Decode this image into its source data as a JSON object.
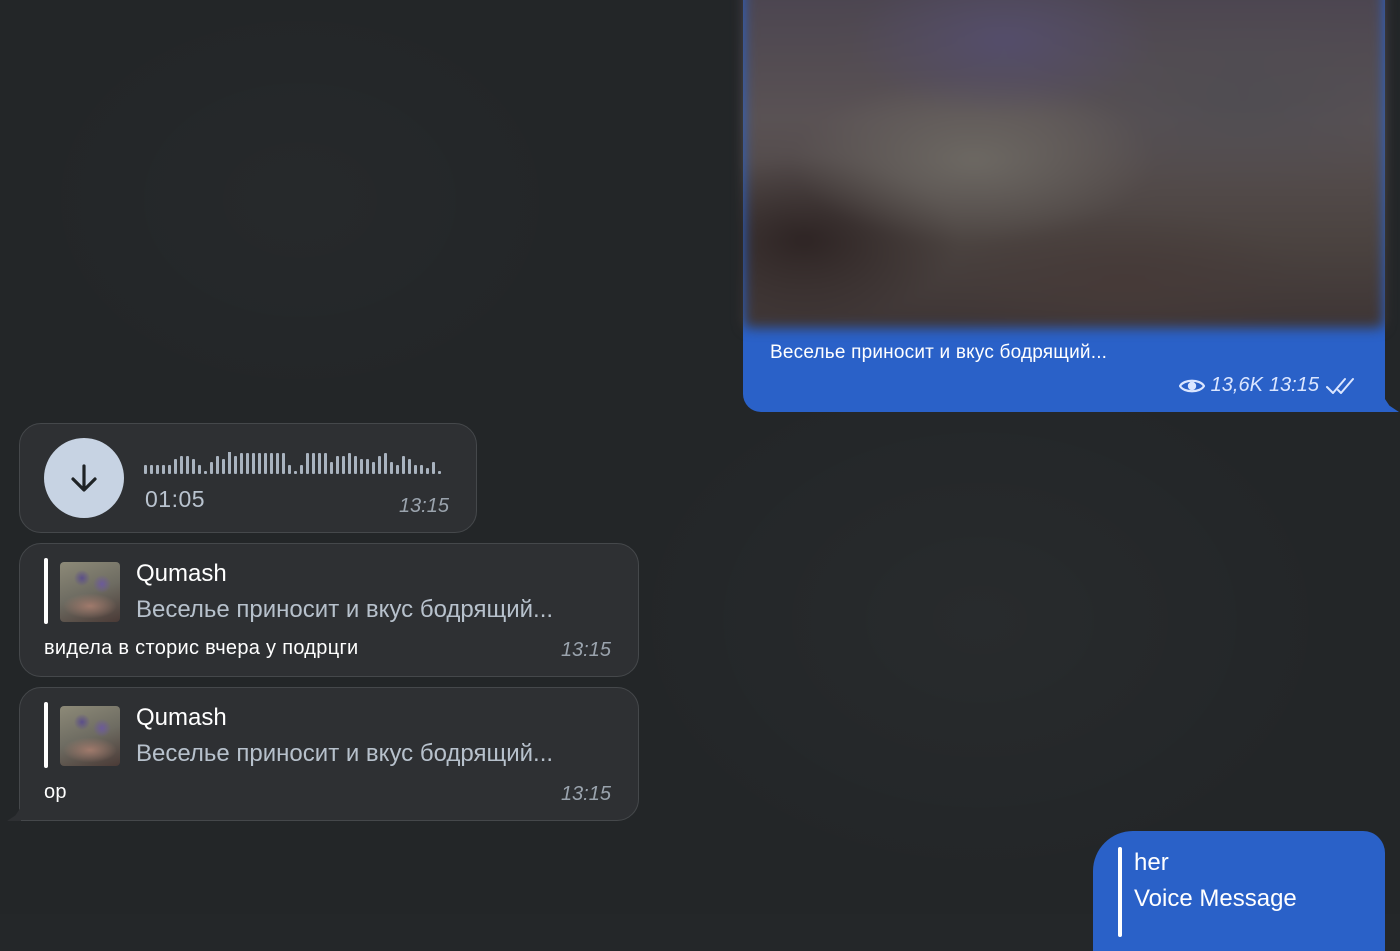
{
  "colors": {
    "background": "#232628",
    "outgoing_bubble": "#2a61c8",
    "incoming_bubble": "#2e3033",
    "secondary_text": "#9aa3ad"
  },
  "outgoing_media": {
    "caption": "Веселье приносит и вкус бодрящий...",
    "views": "13,6K",
    "time": "13:15",
    "views_icon": "eye-icon",
    "status_icon": "double-check-icon"
  },
  "voice_message": {
    "duration": "01:05",
    "time": "13:15",
    "button_icon": "download-arrow-icon",
    "waveform_levels": [
      3,
      3,
      3,
      3,
      3,
      5,
      6,
      6,
      5,
      3,
      1,
      4,
      6,
      5,
      8,
      6,
      7,
      7,
      7,
      7,
      7,
      7,
      7,
      7,
      3,
      1,
      3,
      7,
      7,
      7,
      7,
      4,
      6,
      6,
      7,
      6,
      5,
      5,
      4,
      6,
      7,
      4,
      3,
      6,
      5,
      3,
      3,
      2,
      4,
      1
    ]
  },
  "reply_messages": [
    {
      "author": "Qumash",
      "quoted": "Веселье приносит и вкус бодрящий...",
      "text": "видела в сторис вчера у подрцги",
      "time": "13:15"
    },
    {
      "author": "Qumash",
      "quoted": "Веселье приносит и вкус бодрящий...",
      "text": "ор",
      "time": "13:15"
    }
  ],
  "outgoing_reply": {
    "author": "her",
    "quoted": "Voice Message"
  }
}
